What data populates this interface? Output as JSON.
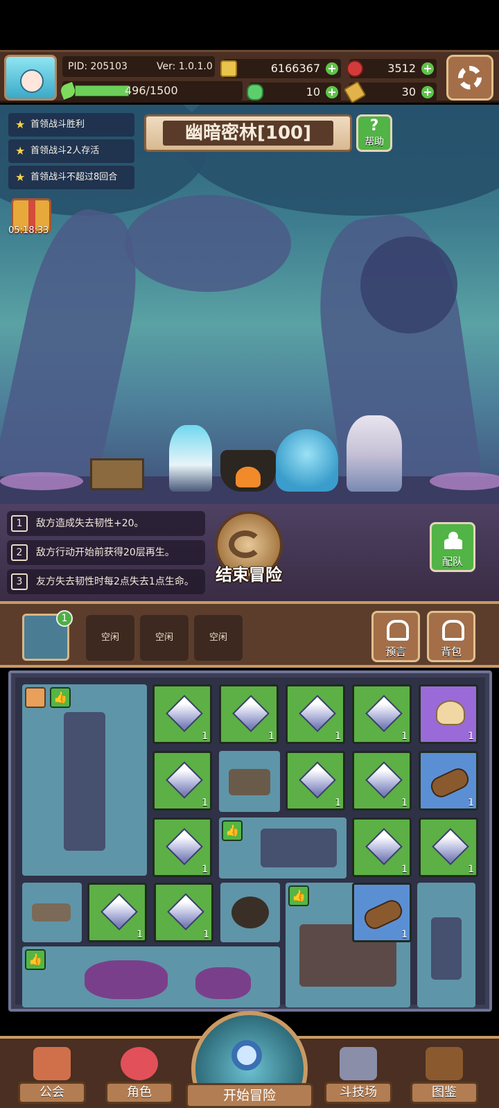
{
  "header": {
    "pid": "PID: 205103",
    "version": "Ver: 1.0.1.0",
    "xp": "496/1500",
    "xp_progress": 0.33,
    "gold": "6166367",
    "ruby": "3512",
    "clover": "10",
    "key": "30"
  },
  "quests": [
    "首领战斗胜利",
    "首领战斗2人存活",
    "首领战斗不超过8回合"
  ],
  "gift_timer": "05:18:33",
  "stage": {
    "title": "幽暗密林[100]",
    "help_label": "帮助"
  },
  "effects": [
    {
      "num": "1",
      "text": "敌方造成失去韧性+20。"
    },
    {
      "num": "2",
      "text": "敌方行动开始前获得20层再生。"
    },
    {
      "num": "3",
      "text": "友方失去韧性时每2点失去1点生命。"
    }
  ],
  "end_adventure": "结束冒险",
  "team_label": "配队",
  "slots": {
    "badge": "1",
    "idle": [
      "空闲",
      "空闲",
      "空闲"
    ],
    "prophecy": "预言",
    "backpack": "背包"
  },
  "inventory": {
    "count": "1"
  },
  "nav": {
    "guild": "公会",
    "character": "角色",
    "start": "开始冒险",
    "arena": "斗技场",
    "codex": "图鉴"
  },
  "colors": {
    "accent_green": "#5cb045",
    "wood": "#4a2f22",
    "gold_trim": "#c99a64"
  }
}
